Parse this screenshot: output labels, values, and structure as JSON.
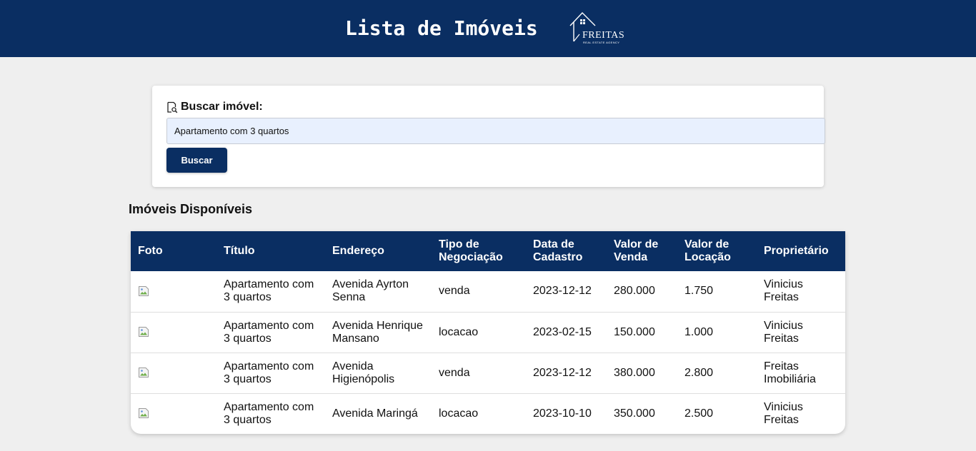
{
  "header": {
    "title": "Lista de Imóveis",
    "logo_word": "FREITAS",
    "logo_sub": "REAL ESTATE AGENCY",
    "background": "#0a2e62"
  },
  "search": {
    "icon": "search-document-icon",
    "label": "Buscar imóvel:",
    "value": "Apartamento com 3 quartos",
    "button_label": "Buscar"
  },
  "listing": {
    "title": "Imóveis Disponíveis",
    "columns": [
      "Foto",
      "Título",
      "Endereço",
      "Tipo de Negociação",
      "Data de Cadastro",
      "Valor de Venda",
      "Valor de Locação",
      "Proprietário"
    ],
    "rows": [
      {
        "titulo": "Apartamento com 3 quartos",
        "endereco": "Avenida Ayrton Senna",
        "tipo": "venda",
        "data": "2023-12-12",
        "venda": "280.000",
        "locacao": "1.750",
        "proprietario": "Vinicius Freitas"
      },
      {
        "titulo": "Apartamento com 3 quartos",
        "endereco": "Avenida Henrique Mansano",
        "tipo": "locacao",
        "data": "2023-02-15",
        "venda": "150.000",
        "locacao": "1.000",
        "proprietario": "Vinicius Freitas"
      },
      {
        "titulo": "Apartamento com 3 quartos",
        "endereco": "Avenida Higienópolis",
        "tipo": "venda",
        "data": "2023-12-12",
        "venda": "380.000",
        "locacao": "2.800",
        "proprietario": "Freitas Imobiliária"
      },
      {
        "titulo": "Apartamento com 3 quartos",
        "endereco": "Avenida Maringá",
        "tipo": "locacao",
        "data": "2023-10-10",
        "venda": "350.000",
        "locacao": "2.500",
        "proprietario": "Vinicius Freitas"
      }
    ]
  }
}
